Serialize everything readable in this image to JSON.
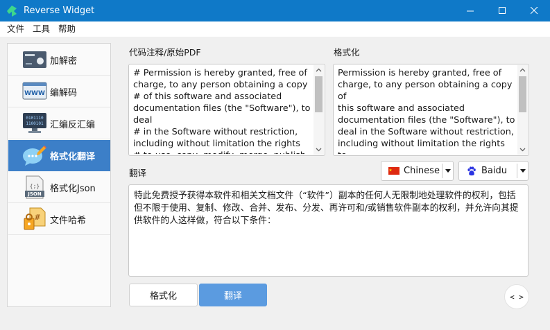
{
  "window": {
    "title": "Reverse Widget",
    "controls": [
      "minimize",
      "maximize",
      "close"
    ]
  },
  "menu": [
    "文件",
    "工具",
    "帮助"
  ],
  "sidebar": {
    "items": [
      {
        "label": "加解密",
        "icon": "encryption-card-icon",
        "active": false
      },
      {
        "label": "编解码",
        "icon": "www-icon",
        "active": false
      },
      {
        "label": "汇编反汇编",
        "icon": "binary-monitor-icon",
        "active": false
      },
      {
        "label": "格式化翻译",
        "icon": "chat-pencil-icon",
        "active": true
      },
      {
        "label": "格式化Json",
        "icon": "json-file-icon",
        "active": false
      },
      {
        "label": "文件哈希",
        "icon": "hash-file-icon",
        "active": false
      }
    ]
  },
  "source": {
    "label": "代码注释/原始PDF",
    "text": "# Permission is hereby granted, free of\ncharge, to any person obtaining a copy\n# of this software and associated\ndocumentation files (the \"Software\"), to\ndeal\n# in the Software without restriction,\nincluding without limitation the rights\n# to use, copy, modify, merge, publish,"
  },
  "formatted": {
    "label": "格式化",
    "text": "Permission is hereby granted, free of\ncharge, to any person obtaining a copy of\nthis software and associated\ndocumentation files (the \"Software\"), to\ndeal in the Software without restriction,\nincluding without limitation the rights to\nuse, copy, modify, merge, publish,\ndistribute, sublicense, and/or sell copies of"
  },
  "translation": {
    "label": "翻译",
    "language": "Chinese",
    "engine": "Baidu",
    "text": "特此免费授予获得本软件和相关文档文件（“软件”）副本的任何人无限制地处理软件的权利，包括但不限于使用、复制、修改、合并、发布、分发、再许可和/或销售软件副本的权利，并允许向其提供软件的人这样做，符合以下条件："
  },
  "buttons": {
    "format": "格式化",
    "translate": "翻译",
    "swap": "< >"
  },
  "colors": {
    "titlebar": "#0f79c8",
    "active": "#3c7fc8",
    "translate_button": "#5b9be0"
  }
}
